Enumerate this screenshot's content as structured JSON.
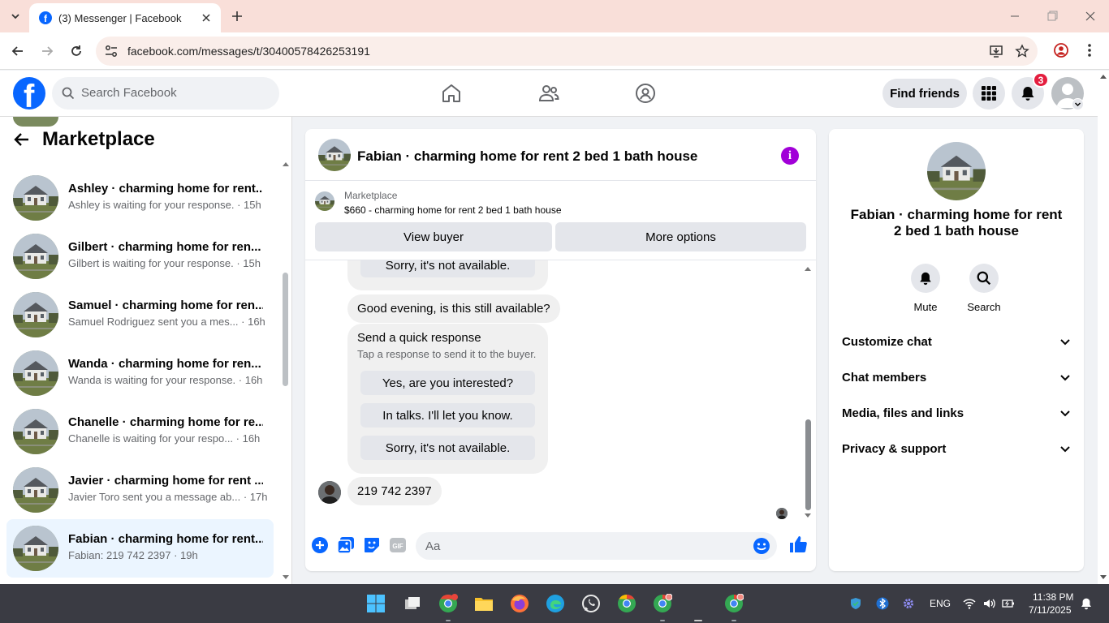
{
  "browser": {
    "tab_title": "(3) Messenger | Facebook",
    "url": "facebook.com/messages/t/30400578426253191"
  },
  "header": {
    "search_placeholder": "Search Facebook",
    "find_friends": "Find friends",
    "notif_count": "3",
    "logo_letter": "f"
  },
  "sidebar": {
    "title": "Marketplace",
    "items": [
      {
        "name": "Ashley · charming home for rent...",
        "preview": "Ashley is waiting for your response. · 15h"
      },
      {
        "name": "Gilbert · charming home for ren...",
        "preview": "Gilbert is waiting for your response. · 15h"
      },
      {
        "name": "Samuel · charming home for ren...",
        "preview": "Samuel Rodriguez sent you a mes... · 16h"
      },
      {
        "name": "Wanda · charming home for ren...",
        "preview": "Wanda is waiting for your response. · 16h"
      },
      {
        "name": "Chanelle · charming home for re...",
        "preview": "Chanelle is waiting for your respo... · 16h"
      },
      {
        "name": "Javier · charming home for rent ...",
        "preview": "Javier Toro sent you a message ab... · 17h"
      },
      {
        "name": "Fabian · charming home for rent...",
        "preview": "Fabian: 219 742 2397 · 19h"
      }
    ]
  },
  "chat": {
    "title": "Fabian · charming home for rent 2 bed 1 bath house",
    "marketplace_label": "Marketplace",
    "listing": "$660 - charming home for rent 2 bed 1 bath house",
    "view_buyer": "View buyer",
    "more_options": "More options",
    "partial_reply": "Sorry, it's not available.",
    "incoming_1": "Good evening, is this still available?",
    "quick": {
      "title": "Send a quick response",
      "subtitle": "Tap a response to send it to the buyer.",
      "options": [
        "Yes, are you interested?",
        "In talks. I'll let you know.",
        "Sorry, it's not available."
      ]
    },
    "incoming_2": "219 742 2397",
    "composer_placeholder": "Aa"
  },
  "details": {
    "name": "Fabian · charming home for rent 2 bed 1 bath house",
    "mute": "Mute",
    "search": "Search",
    "sections": [
      "Customize chat",
      "Chat members",
      "Media, files and links",
      "Privacy & support"
    ]
  },
  "taskbar": {
    "lang": "ENG",
    "time": "11:38 PM",
    "date": "7/11/2025"
  },
  "colors": {
    "brand": "#0866ff",
    "accent": "#a100d8",
    "badge": "#e41e3f"
  }
}
